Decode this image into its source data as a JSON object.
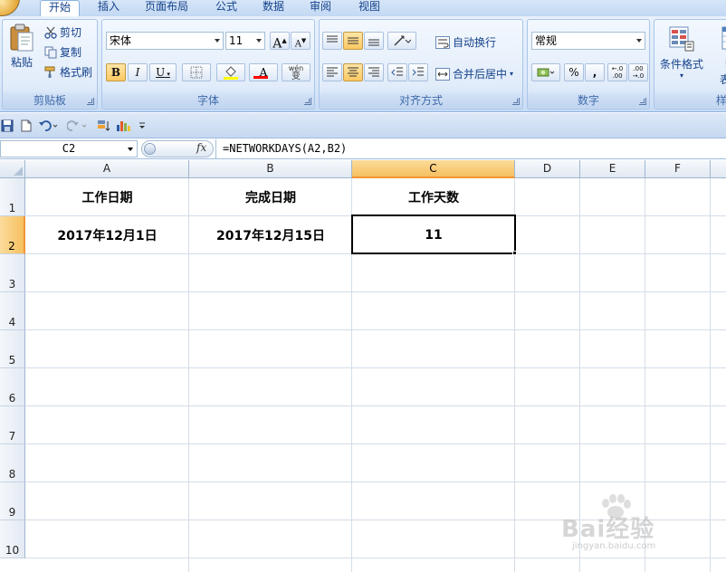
{
  "tabs": [
    {
      "label": "开始",
      "active": true
    },
    {
      "label": "插入"
    },
    {
      "label": "页面布局"
    },
    {
      "label": "公式"
    },
    {
      "label": "数据"
    },
    {
      "label": "审阅"
    },
    {
      "label": "视图"
    }
  ],
  "clipboard": {
    "paste_label": "粘贴",
    "cut_label": "剪切",
    "copy_label": "复制",
    "format_painter_label": "格式刷",
    "group_label": "剪贴板"
  },
  "font": {
    "font_name": "宋体",
    "font_size": "11",
    "grow_label": "A",
    "shrink_label": "A",
    "bold_label": "B",
    "italic_label": "I",
    "underline_label": "U",
    "color_label": "A",
    "phonetic_label": "wén",
    "phonetic_sub": "变",
    "group_label": "字体"
  },
  "alignment": {
    "wrap_label": "自动换行",
    "merge_label": "合并后居中",
    "group_label": "对齐方式"
  },
  "number": {
    "format": "常规",
    "percent_label": "%",
    "comma_label": ",",
    "inc_decimal_label": "+.0\n.00",
    "dec_decimal_label": ".00\n+.0",
    "group_label": "数字"
  },
  "styles": {
    "conditional_label": "条件格式",
    "table_label_top": "套",
    "table_label_bottom": "表格",
    "group_label_partial": "样"
  },
  "formula_bar": {
    "name_box": "C2",
    "fx_label": "fx",
    "formula": "=NETWORKDAYS(A2,B2)"
  },
  "grid": {
    "columns": [
      "A",
      "B",
      "C",
      "D",
      "E",
      "F"
    ],
    "rows": [
      "1",
      "2",
      "3",
      "4",
      "5",
      "6",
      "7",
      "8",
      "9",
      "10"
    ],
    "selected_column": "C",
    "selected_row": "2",
    "cells": {
      "A1": "工作日期",
      "B1": "完成日期",
      "C1": "工作天数",
      "A2": "2017年12月1日",
      "B2": "2017年12月15日",
      "C2": "11"
    }
  },
  "watermark": {
    "text": "Bai经验",
    "url": "jingyan.baidu.com"
  },
  "colors": {
    "ribbon_text": "#15428b",
    "selection_header": "#f6c060",
    "highlight": "#fbc861"
  }
}
